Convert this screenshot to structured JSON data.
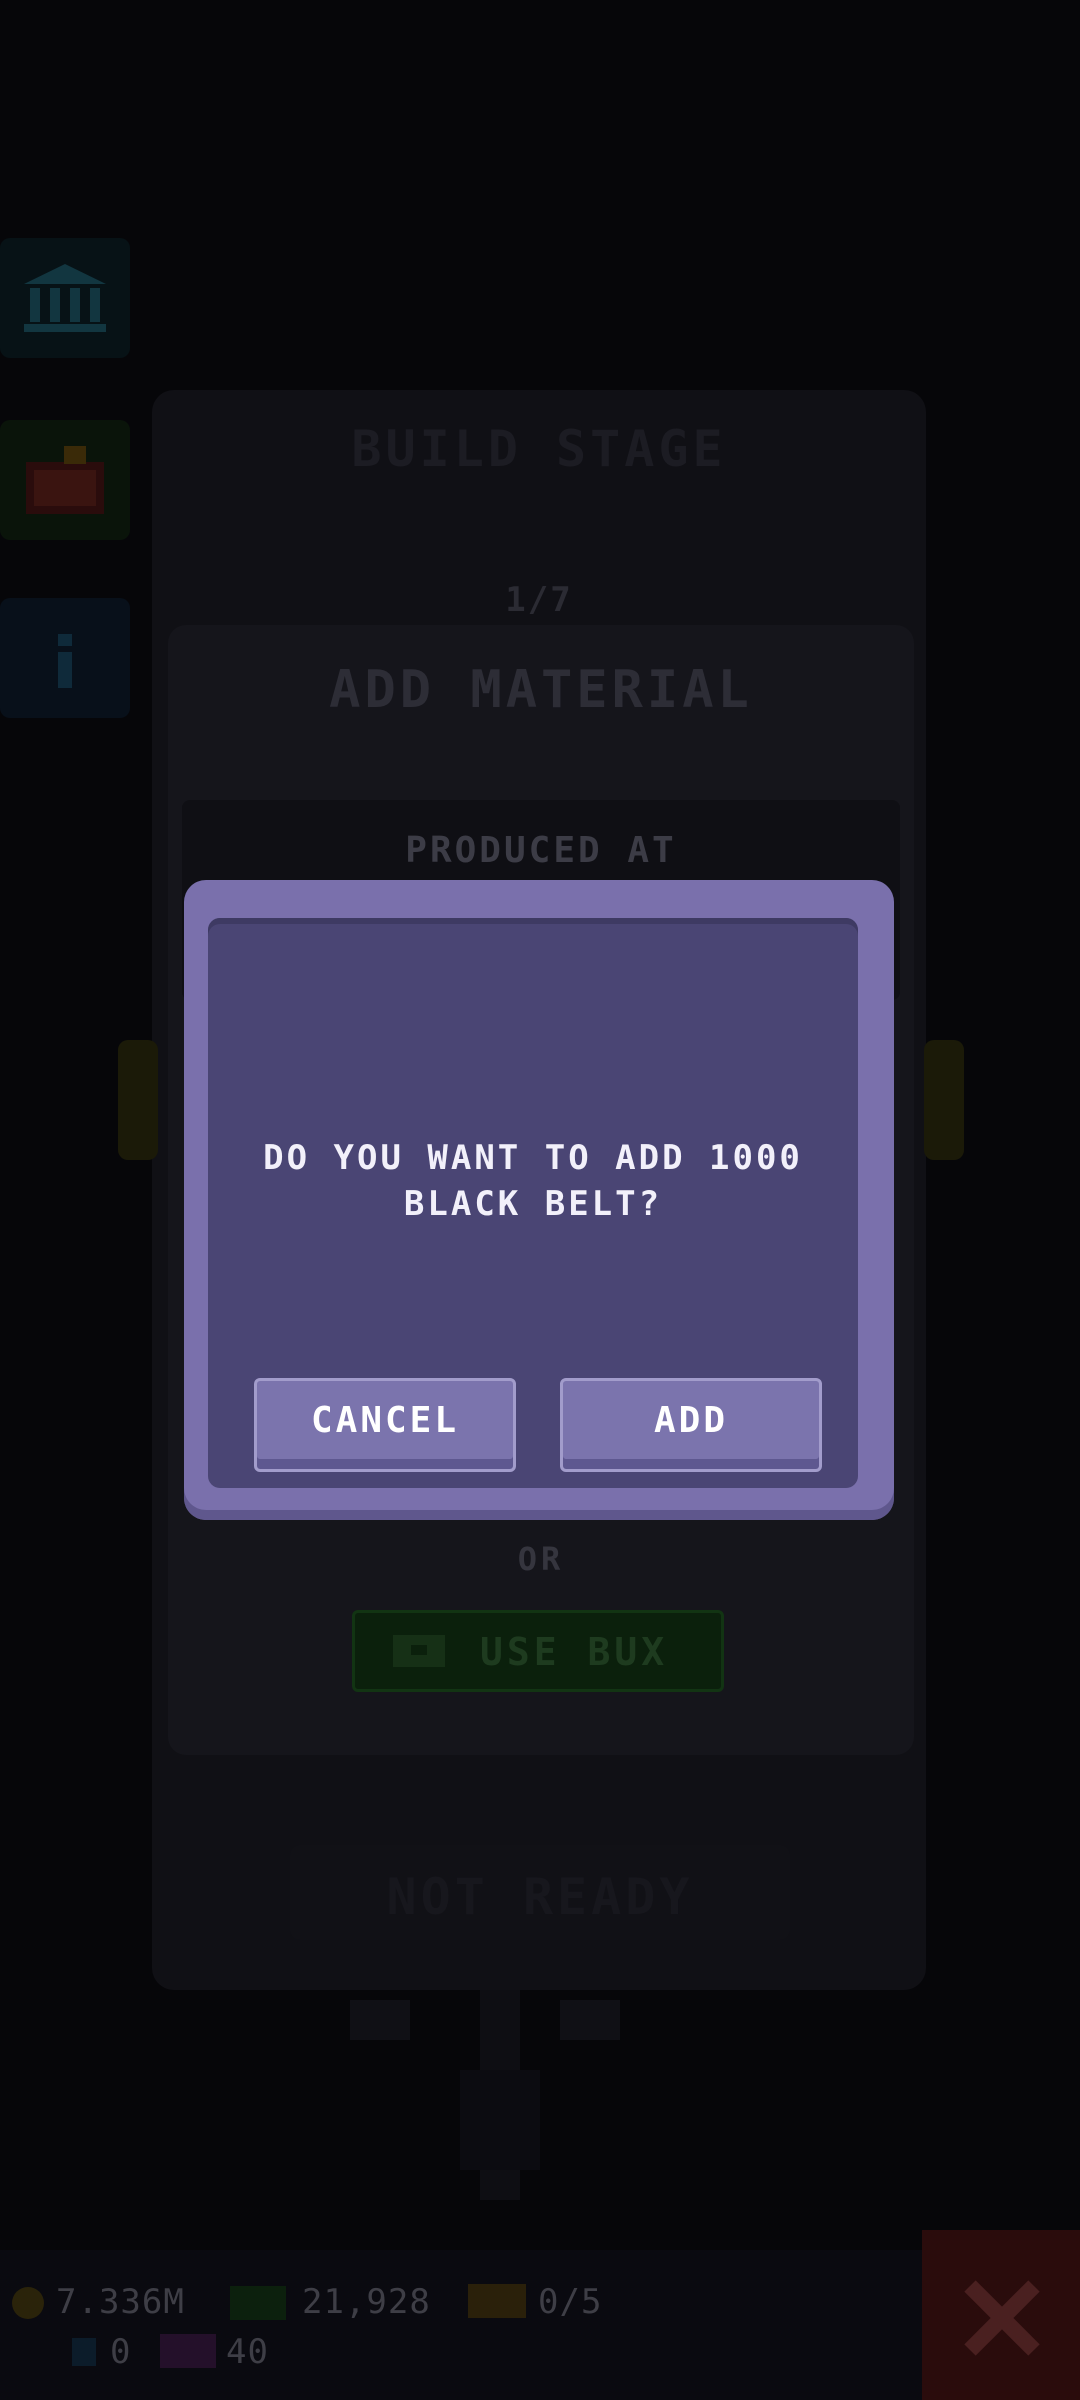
{
  "background": {
    "build_stage": {
      "title": "BUILD STAGE",
      "progress": "1/7"
    },
    "add_material": {
      "title": "ADD MATERIAL",
      "produced_label": "PRODUCED AT"
    },
    "or_label": "OR",
    "use_bux_label": "USE BUX",
    "not_ready_label": "NOT READY"
  },
  "resources": {
    "coins": "7.336M",
    "cash": "21,928",
    "tickets": "0/5",
    "gems": "0",
    "tv": "40"
  },
  "dialog": {
    "message": "DO YOU WANT TO ADD 1000 BLACK BELT?",
    "cancel_label": "CANCEL",
    "add_label": "ADD"
  },
  "colors": {
    "dialog_frame": "#7a70ac",
    "dialog_body": "#4a4574",
    "button": "#7b74ad",
    "overlay": "#060609"
  }
}
